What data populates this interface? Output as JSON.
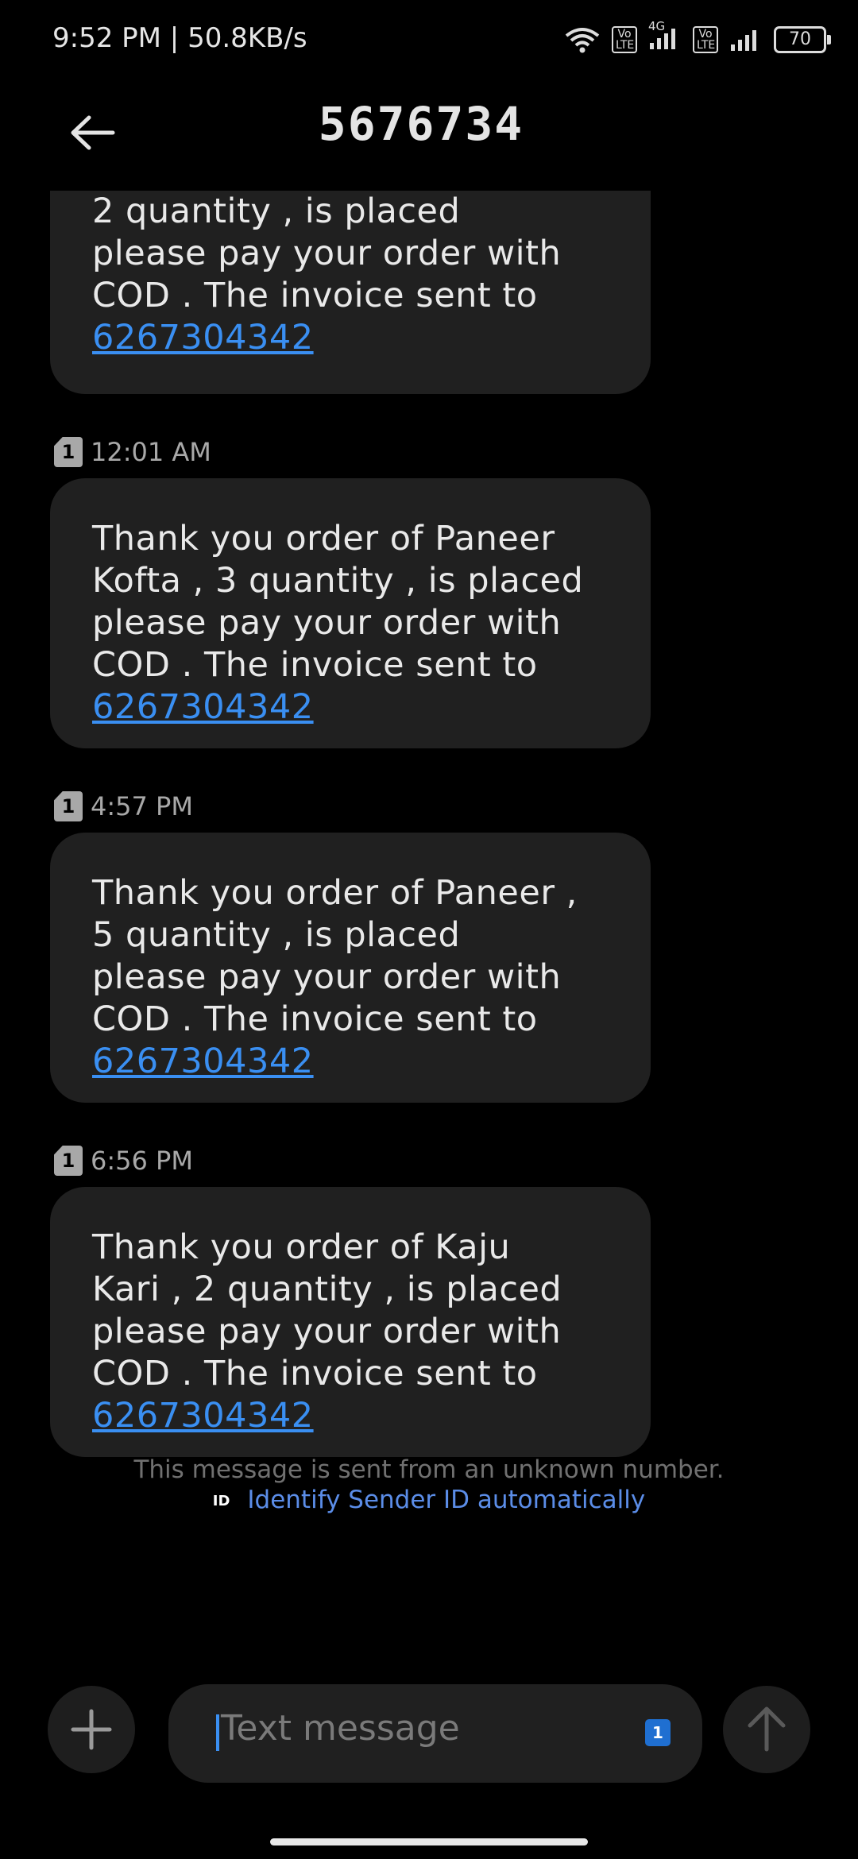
{
  "status_bar": {
    "time_speed": "9:52 PM | 50.8KB/s",
    "network_type": "4G",
    "volte_label": "Vo LTE",
    "battery": "70"
  },
  "header": {
    "title": "5676734"
  },
  "messages": [
    {
      "timestamp": "",
      "lines": [
        "2 quantity , is placed",
        "please pay your order with",
        "COD . The invoice sent to"
      ],
      "link": "6267304342"
    },
    {
      "timestamp": "12:01 AM",
      "sim": "1",
      "lines": [
        "Thank you order of Paneer",
        "Kofta , 3 quantity , is placed",
        "please pay your order with",
        "COD . The invoice sent to"
      ],
      "link": "6267304342"
    },
    {
      "timestamp": "4:57 PM",
      "sim": "1",
      "lines": [
        "Thank you order of Paneer ,",
        "5 quantity , is placed",
        "please pay your order with",
        "COD . The invoice sent to"
      ],
      "link": "6267304342"
    },
    {
      "timestamp": "6:56 PM",
      "sim": "1",
      "lines": [
        "Thank you order of Kaju",
        "Kari , 2 quantity , is placed",
        "please pay your order with",
        "COD . The invoice sent to"
      ],
      "link": "6267304342"
    }
  ],
  "notice": {
    "text": "This message is sent from an unknown number.",
    "id_badge": "ID",
    "identify_link": "Identify Sender ID automatically"
  },
  "composer": {
    "placeholder": "Text message",
    "sim_badge": "1"
  }
}
